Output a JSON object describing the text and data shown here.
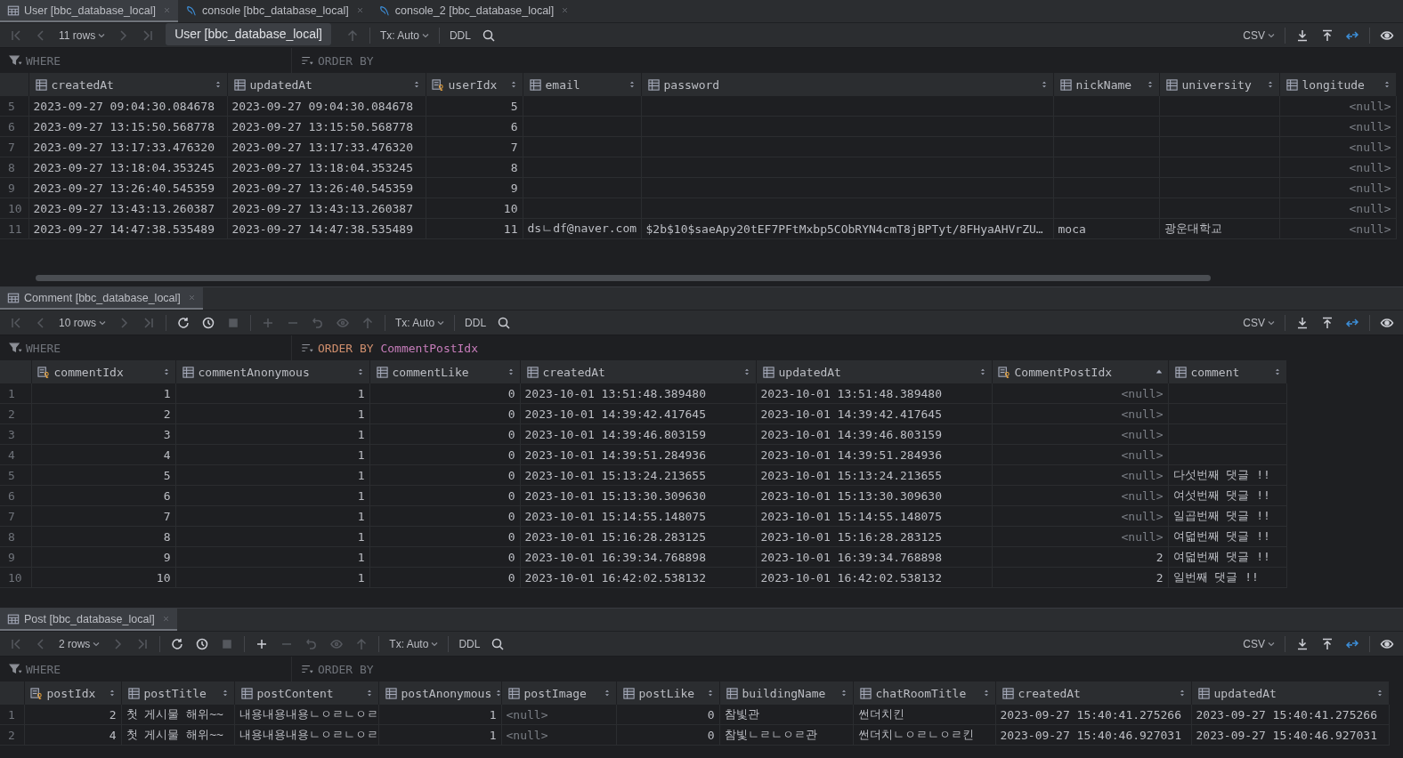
{
  "panels": [
    {
      "tabs": [
        {
          "kind": "table",
          "label": "User [bbc_database_local]",
          "selected": true
        },
        {
          "kind": "console",
          "label": "console [bbc_database_local]",
          "selected": false
        },
        {
          "kind": "console",
          "label": "console_2 [bbc_database_local]",
          "selected": false
        }
      ],
      "toolbar": {
        "left": [
          {
            "kind": "first",
            "disabled": true
          },
          {
            "kind": "prev",
            "disabled": true
          },
          {
            "kind": "rows",
            "label": "11 rows"
          },
          {
            "kind": "next",
            "disabled": true
          },
          {
            "kind": "last",
            "disabled": true
          },
          {
            "kind": "tooltip",
            "label": "User [bbc_database_local]"
          },
          {
            "kind": "submit",
            "disabled": true
          },
          {
            "kind": "separator"
          },
          {
            "kind": "tx",
            "label": "Tx: Auto"
          },
          {
            "kind": "separator"
          },
          {
            "kind": "ddl",
            "label": "DDL"
          },
          {
            "kind": "search",
            "disabled": false
          }
        ],
        "right": [
          {
            "kind": "csv",
            "label": "CSV"
          },
          {
            "kind": "separator"
          },
          {
            "kind": "download",
            "disabled": false
          },
          {
            "kind": "upload",
            "disabled": false
          },
          {
            "kind": "compare",
            "disabled": false
          },
          {
            "kind": "separator"
          },
          {
            "kind": "eye",
            "disabled": false
          }
        ]
      },
      "filter": {
        "where_placeholder": "WHERE",
        "order_by_placeholder": "ORDER BY"
      },
      "table": {
        "columns": [
          {
            "name": "createdAt",
            "kind": "column",
            "sorted": false
          },
          {
            "name": "updatedAt",
            "kind": "column",
            "sorted": false
          },
          {
            "name": "userIdx",
            "kind": "key",
            "sorted": false
          },
          {
            "name": "email",
            "kind": "column",
            "sorted": false
          },
          {
            "name": "password",
            "kind": "column",
            "sorted": false
          },
          {
            "name": "nickName",
            "kind": "column",
            "sorted": false
          },
          {
            "name": "university",
            "kind": "column",
            "sorted": false
          },
          {
            "name": "longitude",
            "kind": "column",
            "sorted": false
          }
        ],
        "rows": [
          {
            "num": "5",
            "cells": [
              "2023-09-27 09:04:30.084678",
              "2023-09-27 09:04:30.084678",
              "5",
              null,
              null,
              null,
              null,
              {
                "text": "<null>",
                "kind": "null"
              }
            ]
          },
          {
            "num": "6",
            "cells": [
              "2023-09-27 13:15:50.568778",
              "2023-09-27 13:15:50.568778",
              "6",
              null,
              null,
              null,
              null,
              {
                "text": "<null>",
                "kind": "null"
              }
            ]
          },
          {
            "num": "7",
            "cells": [
              "2023-09-27 13:17:33.476320",
              "2023-09-27 13:17:33.476320",
              "7",
              null,
              null,
              null,
              null,
              {
                "text": "<null>",
                "kind": "null"
              }
            ]
          },
          {
            "num": "8",
            "cells": [
              "2023-09-27 13:18:04.353245",
              "2023-09-27 13:18:04.353245",
              "8",
              null,
              null,
              null,
              null,
              {
                "text": "<null>",
                "kind": "null"
              }
            ]
          },
          {
            "num": "9",
            "cells": [
              "2023-09-27 13:26:40.545359",
              "2023-09-27 13:26:40.545359",
              "9",
              null,
              null,
              null,
              null,
              {
                "text": "<null>",
                "kind": "null"
              }
            ]
          },
          {
            "num": "10",
            "cells": [
              "2023-09-27 13:43:13.260387",
              "2023-09-27 13:43:13.260387",
              "10",
              null,
              null,
              null,
              null,
              {
                "text": "<null>",
                "kind": "null"
              }
            ]
          },
          {
            "num": "11",
            "cells": [
              "2023-09-27 14:47:38.535489",
              "2023-09-27 14:47:38.535489",
              "11",
              "dsㄴdf@naver.com",
              "$2b$10$saeApy20tEF7PFtMxbp5CObRYN4cmT8jBPTyt/8FHyaAHVrZU…",
              "moca",
              "광운대학교",
              {
                "text": "<null>",
                "kind": "null"
              }
            ]
          }
        ]
      }
    },
    {
      "tabs": [
        {
          "kind": "table",
          "label": "Comment [bbc_database_local]",
          "selected": true
        }
      ],
      "toolbar": {
        "left": [
          {
            "kind": "first",
            "disabled": true
          },
          {
            "kind": "prev",
            "disabled": true
          },
          {
            "kind": "rows",
            "label": "10 rows"
          },
          {
            "kind": "next",
            "disabled": true
          },
          {
            "kind": "last",
            "disabled": true
          },
          {
            "kind": "separator"
          },
          {
            "kind": "reload",
            "disabled": false
          },
          {
            "kind": "history",
            "disabled": false
          },
          {
            "kind": "stop",
            "disabled": true
          },
          {
            "kind": "separator"
          },
          {
            "kind": "add",
            "disabled": true
          },
          {
            "kind": "remove",
            "disabled": true
          },
          {
            "kind": "revert",
            "disabled": true
          },
          {
            "kind": "preview",
            "disabled": true
          },
          {
            "kind": "submit",
            "disabled": true
          },
          {
            "kind": "separator"
          },
          {
            "kind": "tx",
            "label": "Tx: Auto"
          },
          {
            "kind": "separator"
          },
          {
            "kind": "ddl",
            "label": "DDL"
          },
          {
            "kind": "search",
            "disabled": false
          }
        ],
        "right": [
          {
            "kind": "csv",
            "label": "CSV"
          },
          {
            "kind": "separator"
          },
          {
            "kind": "download",
            "disabled": false
          },
          {
            "kind": "upload",
            "disabled": false
          },
          {
            "kind": "compare",
            "disabled": false
          },
          {
            "kind": "separator"
          },
          {
            "kind": "eye",
            "disabled": false
          }
        ]
      },
      "filter": {
        "where_placeholder": "WHERE",
        "order_by_keyword": "ORDER BY",
        "order_by_value": "CommentPostIdx"
      },
      "table": {
        "columns": [
          {
            "name": "commentIdx",
            "kind": "key",
            "sorted": false
          },
          {
            "name": "commentAnonymous",
            "kind": "column",
            "sorted": false
          },
          {
            "name": "commentLike",
            "kind": "column",
            "sorted": false
          },
          {
            "name": "createdAt",
            "kind": "column",
            "sorted": false
          },
          {
            "name": "updatedAt",
            "kind": "column",
            "sorted": false
          },
          {
            "name": "CommentPostIdx",
            "kind": "key",
            "sorted": true
          },
          {
            "name": "comment",
            "kind": "column",
            "sorted": false
          }
        ],
        "rows": [
          {
            "num": "1",
            "cells": [
              "1",
              "1",
              "0",
              "2023-10-01 13:51:48.389480",
              "2023-10-01 13:51:48.389480",
              {
                "text": "<null>",
                "kind": "null"
              },
              null
            ]
          },
          {
            "num": "2",
            "cells": [
              "2",
              "1",
              "0",
              "2023-10-01 14:39:42.417645",
              "2023-10-01 14:39:42.417645",
              {
                "text": "<null>",
                "kind": "null"
              },
              null
            ]
          },
          {
            "num": "3",
            "cells": [
              "3",
              "1",
              "0",
              "2023-10-01 14:39:46.803159",
              "2023-10-01 14:39:46.803159",
              {
                "text": "<null>",
                "kind": "null"
              },
              null
            ]
          },
          {
            "num": "4",
            "cells": [
              "4",
              "1",
              "0",
              "2023-10-01 14:39:51.284936",
              "2023-10-01 14:39:51.284936",
              {
                "text": "<null>",
                "kind": "null"
              },
              null
            ]
          },
          {
            "num": "5",
            "cells": [
              "5",
              "1",
              "0",
              "2023-10-01 15:13:24.213655",
              "2023-10-01 15:13:24.213655",
              {
                "text": "<null>",
                "kind": "null"
              },
              "다섯번째 댓글 !!"
            ]
          },
          {
            "num": "6",
            "cells": [
              "6",
              "1",
              "0",
              "2023-10-01 15:13:30.309630",
              "2023-10-01 15:13:30.309630",
              {
                "text": "<null>",
                "kind": "null"
              },
              "여섯번째 댓글 !!"
            ]
          },
          {
            "num": "7",
            "cells": [
              "7",
              "1",
              "0",
              "2023-10-01 15:14:55.148075",
              "2023-10-01 15:14:55.148075",
              {
                "text": "<null>",
                "kind": "null"
              },
              "일곱번째 댓글 !!"
            ]
          },
          {
            "num": "8",
            "cells": [
              "8",
              "1",
              "0",
              "2023-10-01 15:16:28.283125",
              "2023-10-01 15:16:28.283125",
              {
                "text": "<null>",
                "kind": "null"
              },
              "여덟번째 댓글 !!"
            ]
          },
          {
            "num": "9",
            "cells": [
              "9",
              "1",
              "0",
              "2023-10-01 16:39:34.768898",
              "2023-10-01 16:39:34.768898",
              "2",
              "여덟번째 댓글 !!"
            ]
          },
          {
            "num": "10",
            "cells": [
              "10",
              "1",
              "0",
              "2023-10-01 16:42:02.538132",
              "2023-10-01 16:42:02.538132",
              "2",
              "일번째 댓글 !!"
            ]
          }
        ]
      }
    },
    {
      "tabs": [
        {
          "kind": "table",
          "label": "Post [bbc_database_local]",
          "selected": true
        }
      ],
      "toolbar": {
        "left": [
          {
            "kind": "first",
            "disabled": true
          },
          {
            "kind": "prev",
            "disabled": true
          },
          {
            "kind": "rows",
            "label": "2 rows"
          },
          {
            "kind": "next",
            "disabled": true
          },
          {
            "kind": "last",
            "disabled": true
          },
          {
            "kind": "separator"
          },
          {
            "kind": "reload",
            "disabled": false
          },
          {
            "kind": "history",
            "disabled": false
          },
          {
            "kind": "stop",
            "disabled": true
          },
          {
            "kind": "separator"
          },
          {
            "kind": "add",
            "disabled": false
          },
          {
            "kind": "remove",
            "disabled": true
          },
          {
            "kind": "revert",
            "disabled": true
          },
          {
            "kind": "preview",
            "disabled": true
          },
          {
            "kind": "submit",
            "disabled": true
          },
          {
            "kind": "separator"
          },
          {
            "kind": "tx",
            "label": "Tx: Auto"
          },
          {
            "kind": "separator"
          },
          {
            "kind": "ddl",
            "label": "DDL"
          },
          {
            "kind": "search",
            "disabled": false
          }
        ],
        "right": [
          {
            "kind": "csv",
            "label": "CSV"
          },
          {
            "kind": "separator"
          },
          {
            "kind": "download",
            "disabled": false
          },
          {
            "kind": "upload",
            "disabled": false
          },
          {
            "kind": "compare",
            "disabled": false
          },
          {
            "kind": "separator"
          },
          {
            "kind": "eye",
            "disabled": false
          }
        ]
      },
      "filter": {
        "where_placeholder": "WHERE",
        "order_by_placeholder": "ORDER BY"
      },
      "table": {
        "columns": [
          {
            "name": "postIdx",
            "kind": "key",
            "sorted": false
          },
          {
            "name": "postTitle",
            "kind": "column",
            "sorted": false
          },
          {
            "name": "postContent",
            "kind": "column",
            "sorted": false
          },
          {
            "name": "postAnonymous",
            "kind": "column",
            "sorted": false
          },
          {
            "name": "postImage",
            "kind": "column",
            "sorted": false
          },
          {
            "name": "postLike",
            "kind": "column",
            "sorted": false
          },
          {
            "name": "buildingName",
            "kind": "column",
            "sorted": false
          },
          {
            "name": "chatRoomTitle",
            "kind": "column",
            "sorted": false
          },
          {
            "name": "createdAt",
            "kind": "column",
            "sorted": false
          },
          {
            "name": "updatedAt",
            "kind": "column",
            "sorted": false
          }
        ],
        "rows": [
          {
            "num": "1",
            "cells": [
              "2",
              "첫 게시물 해위~~",
              "내용내용내용ㄴㅇㄹㄴㅇㄹ",
              "1",
              {
                "text": "<null>",
                "kind": "null"
              },
              "0",
              "참빛관",
              "썬더치킨",
              "2023-09-27 15:40:41.275266",
              "2023-09-27 15:40:41.275266"
            ]
          },
          {
            "num": "2",
            "cells": [
              "4",
              "첫 게시물 해위~~",
              "내용내용내용ㄴㅇㄹㄴㅇㄹ",
              "1",
              {
                "text": "<null>",
                "kind": "null"
              },
              "0",
              "참빛ㄴㄹㄴㅇㄹ관",
              "썬더치ㄴㅇㄹㄴㅇㄹ킨",
              "2023-09-27 15:40:46.927031",
              "2023-09-27 15:40:46.927031"
            ]
          }
        ]
      }
    }
  ]
}
